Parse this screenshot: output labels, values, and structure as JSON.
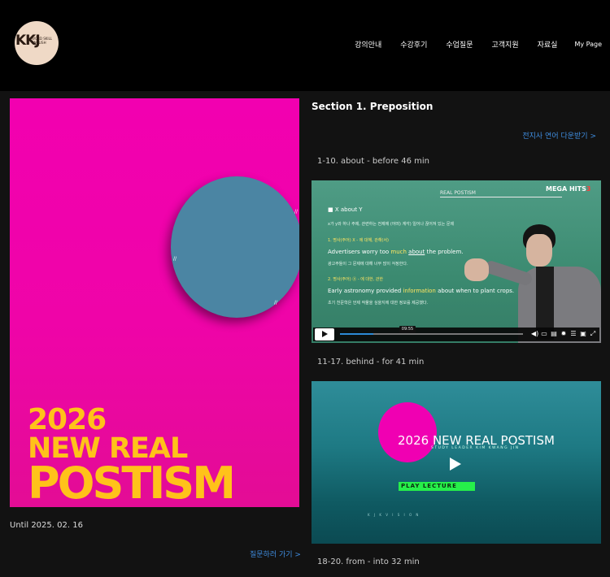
{
  "brand": {
    "logo_text": "KKJ",
    "logo_sub": "WORD SKILL ENGLISH"
  },
  "nav": [
    "강의안내",
    "수강후기",
    "수업질문",
    "고객지원",
    "자료실",
    "My Page"
  ],
  "poster": {
    "year": "2026",
    "line1": "NEW REAL",
    "line2": "POSTISM",
    "until": "Until 2025. 02. 16",
    "ask_link": "질문하러 가기 >"
  },
  "section": {
    "title": "Section 1.  Preposition",
    "download_link": "전지사 연어 다운받기 >"
  },
  "lessons": [
    "1-10. about - before  46 min",
    "11-17. behind - for  41 min",
    "18-20. from - into  32 min"
  ],
  "video1": {
    "board_title": "REAL POSTISM",
    "brand": "MEGA HITS",
    "brand_num": "3",
    "heading": "X about Y",
    "intro": "x가 y와 하나 주제, 관련하는 전제에 (어떠) 계각) 일어나 끊어져 있는 문제",
    "point1": "1. 명사(주어) X - 에 대해, 관해(서)",
    "sentence1_pre": "Advertisers worry too ",
    "sentence1_hl1": "much",
    "sentence1_mid": " ",
    "sentence1_hl2": "about",
    "sentence1_post": " the problem.",
    "trans1": "광고주들이 그 문제에 대해 너무 많이 걱정한다.",
    "point2": "2. 명사(주어) Ⓧ - 에 대한, 관한",
    "sentence2_pre": "Early astronomy provided ",
    "sentence2_hl": "information",
    "sentence2_post": " about when to plant crops.",
    "trans2": "초기 천문학은 언제 작물을 심을지에 대한 정보를 제공했다.",
    "time": "09:55",
    "progress": 0.18
  },
  "video2": {
    "title": "2026 NEW REAL POSTISM",
    "subtitle": "STUDY LEADER  KIM KWANG JIN",
    "button": "PLAY LECTURE",
    "small": "K J K   V I S I O N"
  }
}
